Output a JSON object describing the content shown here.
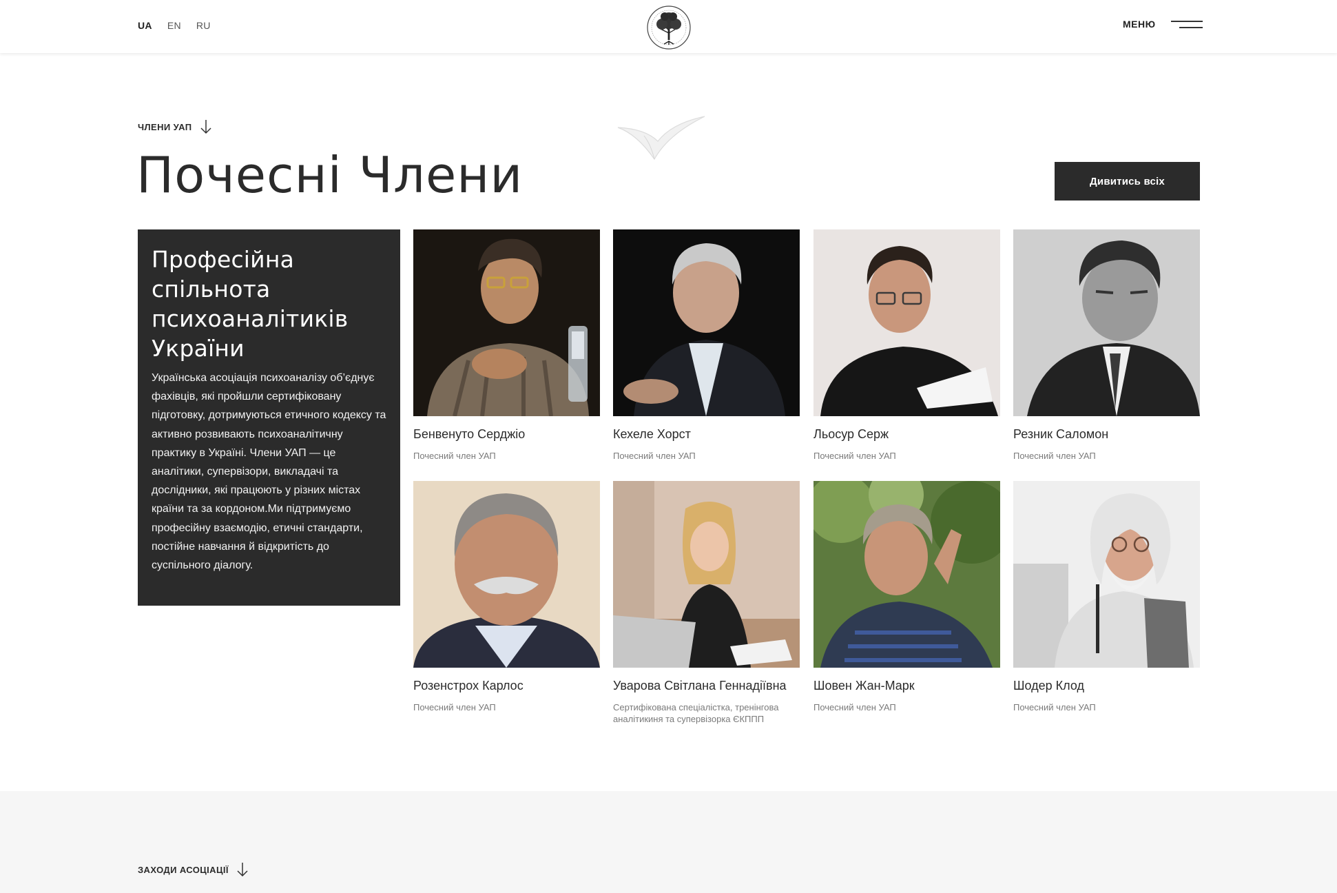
{
  "header": {
    "languages": [
      {
        "label": "UA",
        "active": true
      },
      {
        "label": "EN",
        "active": false
      },
      {
        "label": "RU",
        "active": false
      }
    ],
    "logo_icon": "tree-logo-icon",
    "menu_label": "МЕНЮ",
    "menu_icon": "hamburger-icon"
  },
  "section": {
    "eyebrow": "ЧЛЕНИ УАП",
    "eyebrow_icon": "arrow-down-icon",
    "title": "Почесні Члени",
    "view_all_label": "Дивитись всіх"
  },
  "info_box": {
    "title": "Професійна спільнота психоаналітиків України",
    "text": "Українська асоціація психоаналізу об’єднує фахівців, які пройшли сертифіковану підготовку, дотримуються етичного кодексу та активно розвивають психоаналітичну практику в Україні. Члени УАП — це аналітики, супервізори, викладачі та дослідники, які працюють у різних містах країни та за кордоном.Ми підтримуємо професійну взаємодію, етичні стандарти, постійне навчання й відкритість до суспільного діалогу."
  },
  "members": [
    {
      "name": "Бенвенуто Серджіо",
      "role": "Почесний член УАП"
    },
    {
      "name": "Кехеле Хорст",
      "role": "Почесний член УАП"
    },
    {
      "name": "Льосур Серж",
      "role": "Почесний член УАП"
    },
    {
      "name": "Резник Саломон",
      "role": "Почесний член УАП"
    },
    {
      "name": "Розенстрох Карлос",
      "role": "Почесний член УАП"
    },
    {
      "name": "Уварова Світлана Геннадіївна",
      "role": "Сертифікована спеціалістка, тренінгова аналітикиня та супервізорка ЄКППП"
    },
    {
      "name": "Шовен Жан-Марк",
      "role": "Почесний член УАП"
    },
    {
      "name": "Шодер Клод",
      "role": "Почесний член УАП"
    }
  ],
  "next_section": {
    "eyebrow": "ЗАХОДИ АСОЦІАЦІЇ"
  },
  "colors": {
    "dark": "#2b2b2b",
    "muted": "#7a7a7a",
    "bottom_bg": "#f6f6f6"
  }
}
